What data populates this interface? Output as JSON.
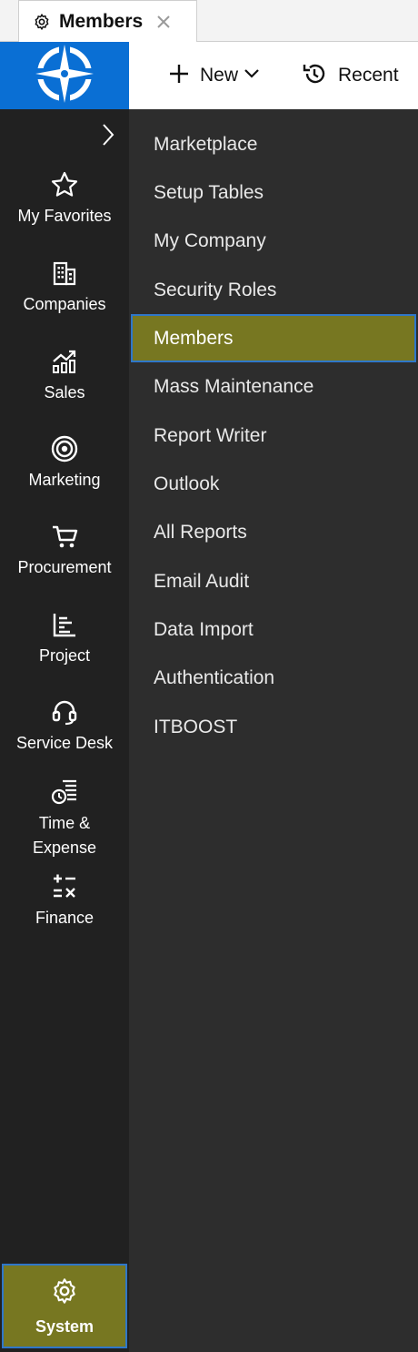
{
  "tab": {
    "label": "Members",
    "icon": "gear-icon",
    "close_icon": "close-icon"
  },
  "header": {
    "logo_icon": "compass-logo-icon",
    "new_label": "New",
    "recent_label": "Recent"
  },
  "rail": {
    "items": [
      {
        "label": "My Favorites",
        "icon": "star-icon"
      },
      {
        "label": "Companies",
        "icon": "building-icon"
      },
      {
        "label": "Sales",
        "icon": "chart-icon"
      },
      {
        "label": "Marketing",
        "icon": "target-icon"
      },
      {
        "label": "Procurement",
        "icon": "cart-icon"
      },
      {
        "label": "Project",
        "icon": "project-chart-icon"
      },
      {
        "label": "Service Desk",
        "icon": "headset-icon"
      },
      {
        "label_line1": "Time &",
        "label_line2": "Expense",
        "icon": "time-expense-icon"
      },
      {
        "label": "Finance",
        "icon": "calculator-icon"
      }
    ],
    "system": {
      "label": "System",
      "icon": "gear-icon"
    }
  },
  "submenu": {
    "items": [
      {
        "label": "Marketplace"
      },
      {
        "label": "Setup Tables"
      },
      {
        "label": "My Company"
      },
      {
        "label": "Security Roles"
      },
      {
        "label": "Members",
        "active": true
      },
      {
        "label": "Mass Maintenance"
      },
      {
        "label": "Report Writer"
      },
      {
        "label": "Outlook"
      },
      {
        "label": "All Reports"
      },
      {
        "label": "Email Audit"
      },
      {
        "label": "Data Import"
      },
      {
        "label": "Authentication"
      },
      {
        "label": "ITBOOST"
      }
    ]
  },
  "colors": {
    "accent_olive": "#777721",
    "brand_blue": "#0a6fd4",
    "rail_bg": "#212121",
    "submenu_bg": "#2d2d2d",
    "active_border": "#2f77c9"
  }
}
